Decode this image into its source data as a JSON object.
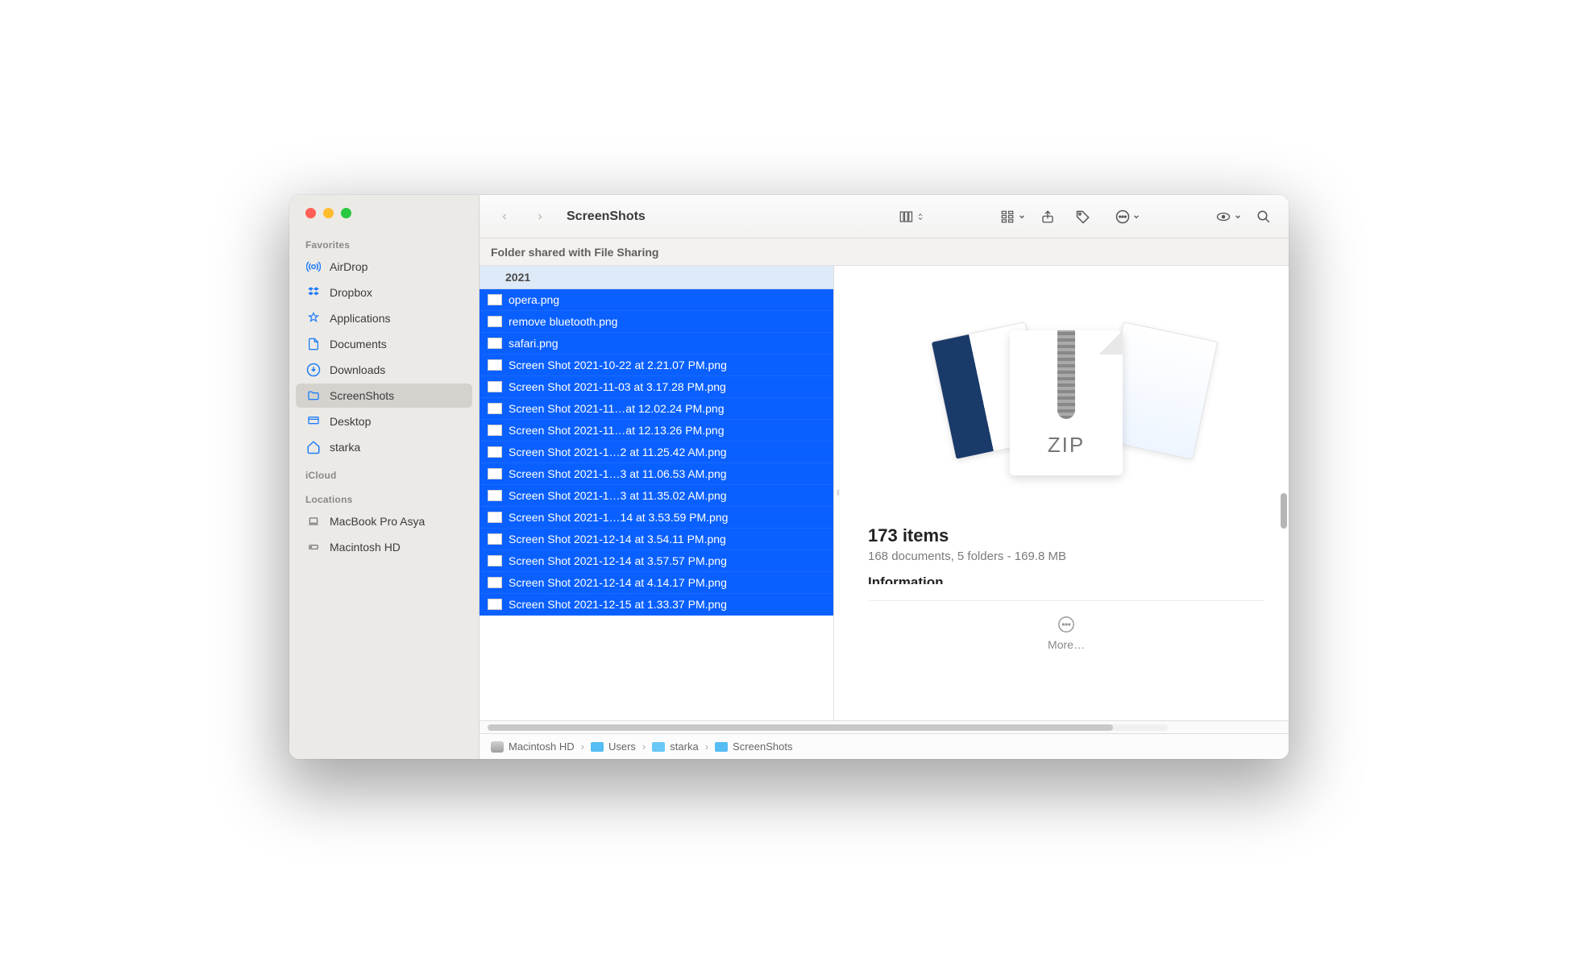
{
  "window_title": "ScreenShots",
  "sidebar": {
    "sections": {
      "favorites_label": "Favorites",
      "icloud_label": "iCloud",
      "locations_label": "Locations"
    },
    "items": [
      {
        "label": "AirDrop",
        "icon": "airdrop"
      },
      {
        "label": "Dropbox",
        "icon": "dropbox"
      },
      {
        "label": "Applications",
        "icon": "applications"
      },
      {
        "label": "Documents",
        "icon": "documents"
      },
      {
        "label": "Downloads",
        "icon": "downloads"
      },
      {
        "label": "ScreenShots",
        "icon": "folder",
        "active": true
      },
      {
        "label": "Desktop",
        "icon": "desktop"
      },
      {
        "label": "starka",
        "icon": "home"
      }
    ],
    "locations": [
      {
        "label": "MacBook Pro Asya",
        "icon": "laptop"
      },
      {
        "label": "Macintosh HD",
        "icon": "disk"
      }
    ]
  },
  "infobar": "Folder shared with File Sharing",
  "group_header": "2021",
  "files": [
    "opera.png",
    "remove bluetooth.png",
    "safari.png",
    "Screen Shot 2021-10-22 at 2.21.07 PM.png",
    "Screen Shot 2021-11-03 at 3.17.28 PM.png",
    "Screen Shot 2021-11…at 12.02.24 PM.png",
    "Screen Shot 2021-11…at 12.13.26 PM.png",
    "Screen Shot 2021-1…2 at 11.25.42 AM.png",
    "Screen Shot 2021-1…3 at 11.06.53 AM.png",
    "Screen Shot 2021-1…3 at 11.35.02 AM.png",
    "Screen Shot 2021-1…14 at 3.53.59 PM.png",
    "Screen Shot 2021-12-14 at 3.54.11 PM.png",
    "Screen Shot 2021-12-14 at 3.57.57 PM.png",
    "Screen Shot 2021-12-14 at 4.14.17 PM.png",
    "Screen Shot 2021-12-15 at 1.33.37 PM.png"
  ],
  "preview": {
    "zip_label": "ZIP",
    "item_count": "173 items",
    "summary": "168 documents, 5 folders - 169.8 MB",
    "info_heading": "Information",
    "more_label": "More…"
  },
  "pathbar": [
    {
      "label": "Macintosh HD",
      "type": "disk"
    },
    {
      "label": "Users",
      "type": "folder"
    },
    {
      "label": "starka",
      "type": "folder"
    },
    {
      "label": "ScreenShots",
      "type": "folder"
    }
  ]
}
